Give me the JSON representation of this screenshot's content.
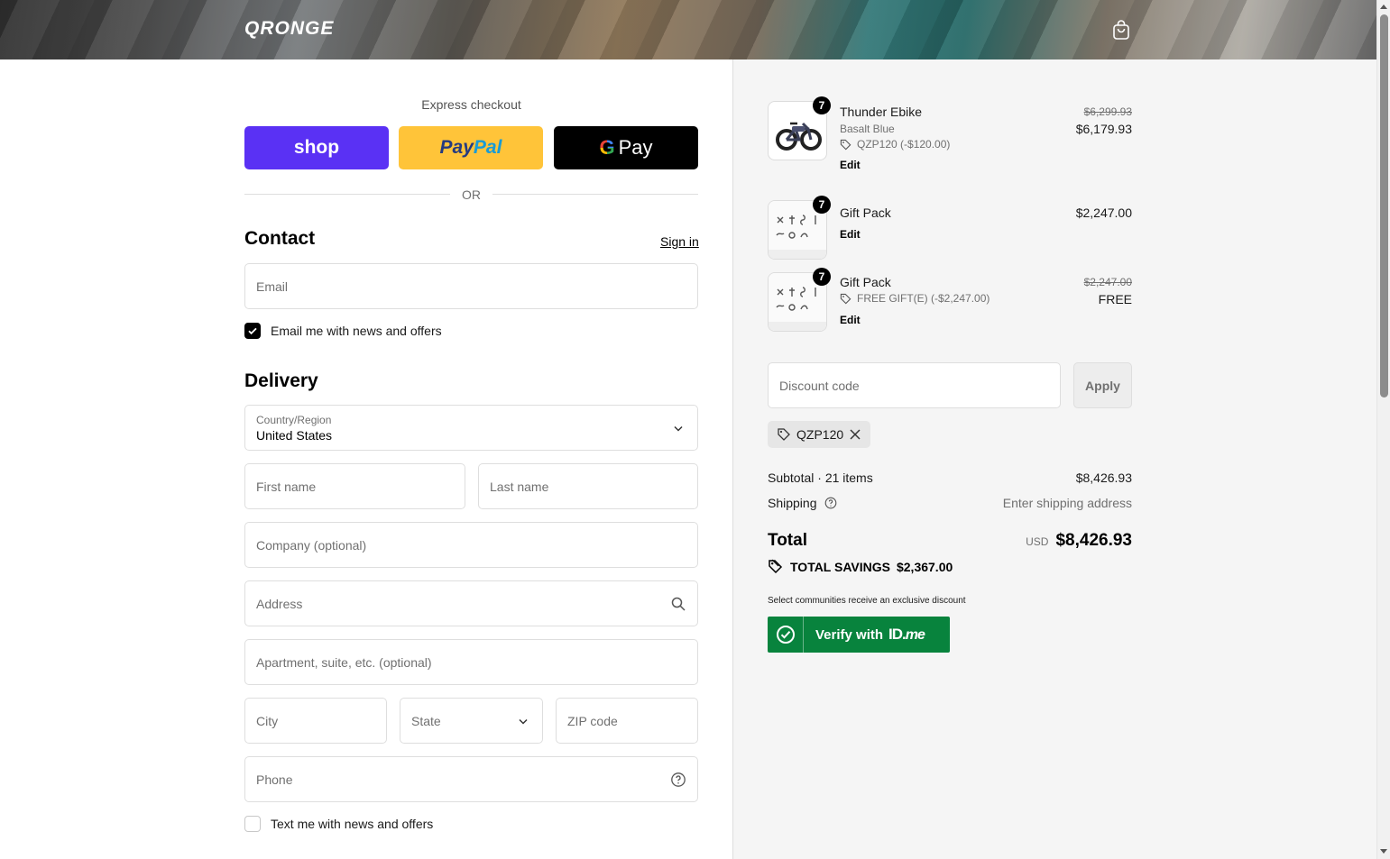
{
  "header": {
    "brand": "QRONGE",
    "cart_icon": "bag-icon"
  },
  "express": {
    "label": "Express checkout",
    "shop_label": "shop",
    "paypal_label_1": "Pay",
    "paypal_label_2": "Pal",
    "gpay_g": "G",
    "gpay_label": "Pay",
    "or_label": "OR"
  },
  "contact": {
    "title": "Contact",
    "signin_label": "Sign in",
    "email_placeholder": "Email",
    "email_news_label": "Email me with news and offers",
    "email_news_checked": true
  },
  "delivery": {
    "title": "Delivery",
    "country_label": "Country/Region",
    "country_value": "United States",
    "first_name_placeholder": "First name",
    "last_name_placeholder": "Last name",
    "company_placeholder": "Company (optional)",
    "address_placeholder": "Address",
    "apartment_placeholder": "Apartment, suite, etc. (optional)",
    "city_placeholder": "City",
    "state_placeholder": "State",
    "zip_placeholder": "ZIP code",
    "phone_placeholder": "Phone",
    "text_news_label": "Text me with news and offers",
    "text_news_checked": false
  },
  "order": {
    "items": [
      {
        "qty": "7",
        "name": "Thunder Ebike",
        "variant": "Basalt Blue",
        "discount": "QZP120 (-$120.00)",
        "edit_label": "Edit",
        "original_price": "$6,299.93",
        "price": "$6,179.93"
      },
      {
        "qty": "7",
        "name": "Gift Pack",
        "edit_label": "Edit",
        "price": "$2,247.00"
      },
      {
        "qty": "7",
        "name": "Gift Pack",
        "discount": "FREE GIFT(E) (-$2,247.00)",
        "edit_label": "Edit",
        "original_price": "$2,247.00",
        "price": "FREE"
      }
    ],
    "discount_placeholder": "Discount code",
    "apply_label": "Apply",
    "applied_code": "QZP120",
    "subtotal_label": "Subtotal · 21 items",
    "subtotal_value": "$8,426.93",
    "shipping_label": "Shipping",
    "shipping_value": "Enter shipping address",
    "total_label": "Total",
    "currency": "USD",
    "total_value": "$8,426.93",
    "savings_label": "TOTAL SAVINGS",
    "savings_value": "$2,367.00",
    "idme_note": "Select communities receive an exclusive discount",
    "idme_label": "Verify with",
    "idme_logo_1": "ID.",
    "idme_logo_2": "me"
  },
  "colors": {
    "shop": "#5a31f4",
    "paypal": "#ffc439",
    "gpay": "#000000",
    "idme": "#08833d"
  }
}
